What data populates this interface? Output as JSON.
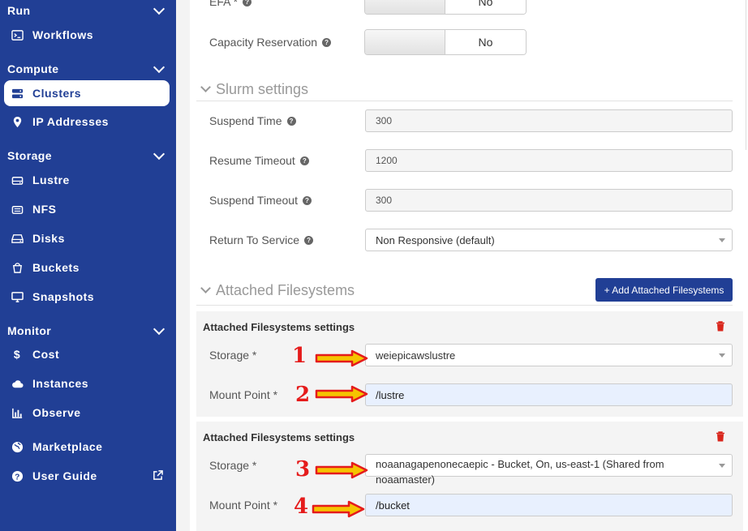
{
  "sidebar": {
    "sections": [
      {
        "title": "Run",
        "items": [
          {
            "label": "Workflows",
            "icon": "terminal-icon"
          }
        ]
      },
      {
        "title": "Compute",
        "items": [
          {
            "label": "Clusters",
            "icon": "server-icon",
            "active": true
          },
          {
            "label": "IP Addresses",
            "icon": "map-pin-icon"
          }
        ]
      },
      {
        "title": "Storage",
        "items": [
          {
            "label": "Lustre",
            "icon": "storage-icon"
          },
          {
            "label": "NFS",
            "icon": "network-storage-icon"
          },
          {
            "label": "Disks",
            "icon": "hard-drive-icon"
          },
          {
            "label": "Buckets",
            "icon": "bucket-icon"
          },
          {
            "label": "Snapshots",
            "icon": "monitor-icon"
          }
        ]
      },
      {
        "title": "Monitor",
        "items": [
          {
            "label": "Cost",
            "icon": "dollar-icon"
          },
          {
            "label": "Instances",
            "icon": "cloud-icon"
          },
          {
            "label": "Observe",
            "icon": "chart-icon"
          }
        ]
      }
    ],
    "extra": [
      {
        "label": "Marketplace",
        "icon": "globe-icon"
      },
      {
        "label": "User Guide",
        "icon": "help-icon",
        "external": true
      }
    ]
  },
  "form": {
    "efa": {
      "label": "EFA *",
      "value": "No"
    },
    "capacity": {
      "label": "Capacity Reservation",
      "value": "No"
    },
    "slurm": {
      "title": "Slurm settings",
      "suspend_time": {
        "label": "Suspend Time",
        "value": "300"
      },
      "resume_timeout": {
        "label": "Resume Timeout",
        "value": "1200"
      },
      "suspend_timeout": {
        "label": "Suspend Timeout",
        "value": "300"
      },
      "return_to_service": {
        "label": "Return To Service",
        "value": "Non Responsive (default)"
      }
    },
    "attached": {
      "title": "Attached Filesystems",
      "add_button": "+ Add Attached Filesystems",
      "entries": [
        {
          "title": "Attached Filesystems settings",
          "storage_label": "Storage *",
          "storage": "weiepicawslustre",
          "mount_label": "Mount Point *",
          "mount": "/lustre"
        },
        {
          "title": "Attached Filesystems settings",
          "storage_label": "Storage *",
          "storage": "noaanagapenonecaepic - Bucket, On, us-east-1 (Shared from noaamaster)",
          "mount_label": "Mount Point *",
          "mount": "/bucket"
        }
      ]
    }
  },
  "annotations": [
    "1",
    "2",
    "3",
    "4"
  ],
  "colors": {
    "sidebar": "#213f95",
    "accent": "#213f95",
    "annotation": "#e51b1b",
    "danger": "#d9261c"
  }
}
